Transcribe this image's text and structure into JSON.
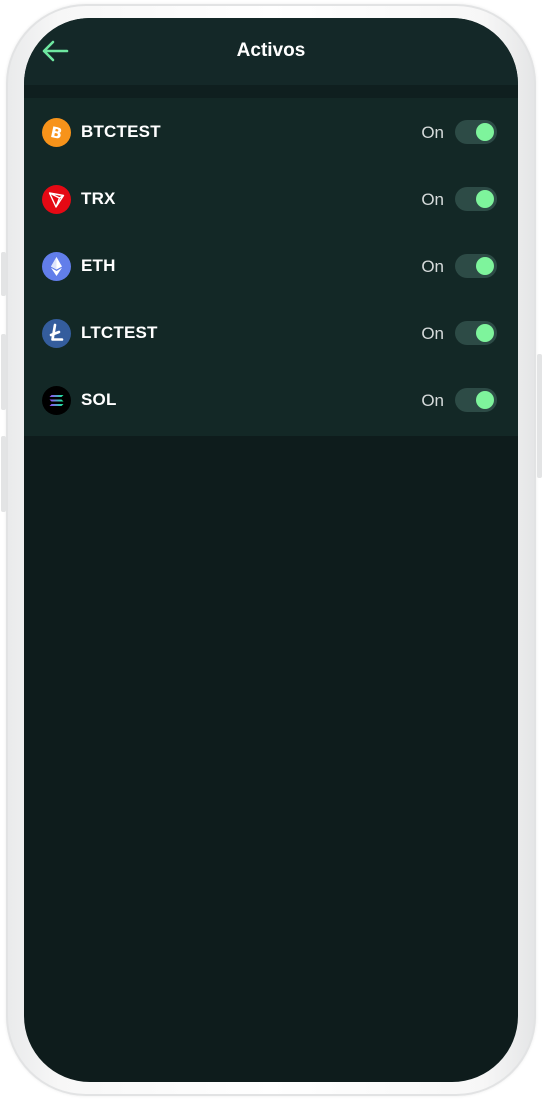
{
  "header": {
    "title": "Activos",
    "back_icon": "arrow-left-icon",
    "accent_color": "#6ee7a0"
  },
  "assets": [
    {
      "name": "BTCTEST",
      "state": "On",
      "enabled": true,
      "icon": "bitcoin-icon",
      "color": "#f7931a"
    },
    {
      "name": "TRX",
      "state": "On",
      "enabled": true,
      "icon": "tron-icon",
      "color": "#e50914"
    },
    {
      "name": "ETH",
      "state": "On",
      "enabled": true,
      "icon": "ethereum-icon",
      "color": "#627eea"
    },
    {
      "name": "LTCTEST",
      "state": "On",
      "enabled": true,
      "icon": "litecoin-icon",
      "color": "#345d9d"
    },
    {
      "name": "SOL",
      "state": "On",
      "enabled": true,
      "icon": "solana-icon",
      "color": "#000000"
    }
  ],
  "colors": {
    "background": "#0e1c1c",
    "list_background": "#132826",
    "toggle_on_knob": "#7ef49c",
    "toggle_track": "#2d4b46"
  }
}
